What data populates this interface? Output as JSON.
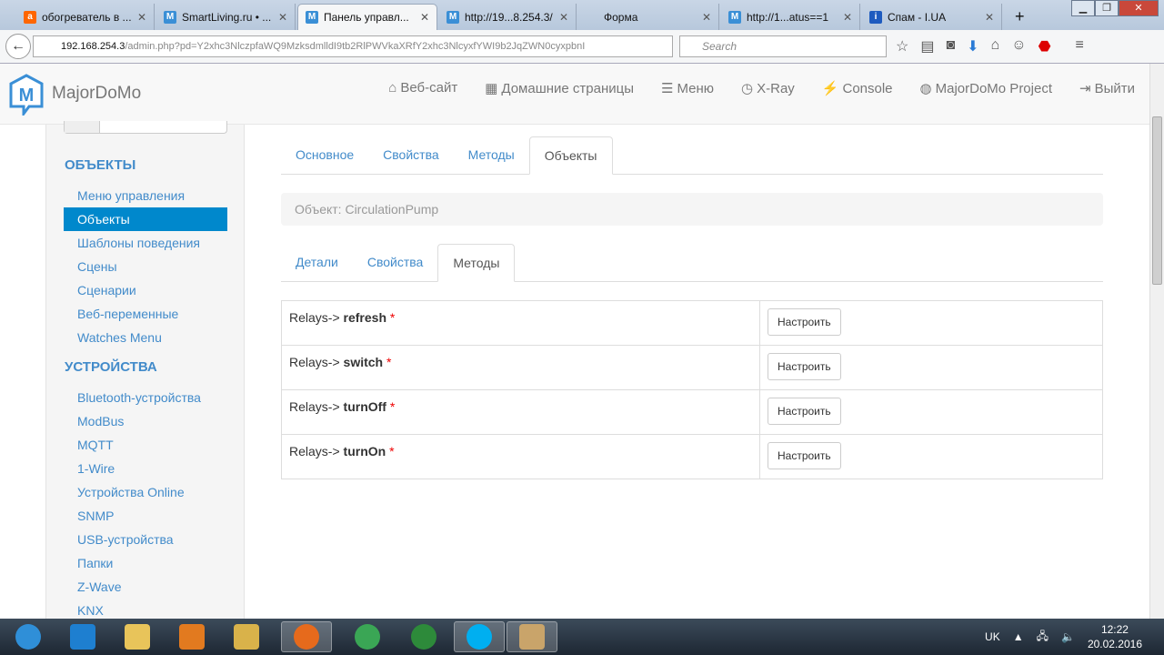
{
  "browser": {
    "tabs": [
      {
        "title": "обогреватель в ...",
        "icon": "amazon-icon",
        "color": "#f60"
      },
      {
        "title": "SmartLiving.ru • ...",
        "icon": "majordomo-icon",
        "color": "#3a8fd6"
      },
      {
        "title": "Панель управл...",
        "icon": "majordomo-icon",
        "color": "#3a8fd6",
        "active": true
      },
      {
        "title": "http://19...8.254.3/",
        "icon": "majordomo-icon",
        "color": "#3a8fd6"
      },
      {
        "title": "Форма",
        "icon": "",
        "color": ""
      },
      {
        "title": "http://1...atus==1",
        "icon": "majordomo-icon",
        "color": "#3a8fd6"
      },
      {
        "title": "Спам - I.UA",
        "icon": "info-icon",
        "color": "#1e5bbf"
      }
    ],
    "url_host": "192.168.254.3",
    "url_path": "/admin.php?pd=Y2xhc3NlczpfaWQ9MzksdmlldI9tb2RlPWVkaXRfY2xhc3NlcyxfYWI9b2JqZWN0cyxpbnI",
    "search_placeholder": "Search"
  },
  "navbar": {
    "brand": "MajorDoMo",
    "items": [
      {
        "label": "Веб-сайт",
        "icon": "home-icon",
        "glyph": "⌂"
      },
      {
        "label": "Домашние страницы",
        "icon": "grid-icon",
        "glyph": "▦"
      },
      {
        "label": "Меню",
        "icon": "list-icon",
        "glyph": "☰"
      },
      {
        "label": "X-Ray",
        "icon": "clock-icon",
        "glyph": "◷"
      },
      {
        "label": "Console",
        "icon": "bolt-icon",
        "glyph": "⚡"
      },
      {
        "label": "MajorDoMo Project",
        "icon": "globe-icon",
        "glyph": "◍"
      },
      {
        "label": "Выйти",
        "icon": "logout-icon",
        "glyph": "⇥"
      }
    ]
  },
  "sidebar": {
    "section1": "ОБЪЕКТЫ",
    "items1": [
      "Меню управления",
      "Объекты",
      "Шаблоны поведения",
      "Сцены",
      "Сценарии",
      "Веб-переменные",
      "Watches Menu"
    ],
    "active": "Объекты",
    "section2": "УСТРОЙСТВА",
    "items2": [
      "Bluetooth-устройства",
      "ModBus",
      "MQTT",
      "1-Wire",
      "Устройства Online",
      "SNMP",
      "USB-устройства",
      "Папки",
      "Z-Wave",
      "KNX"
    ]
  },
  "main": {
    "tabs": [
      "Основное",
      "Свойства",
      "Методы",
      "Объекты"
    ],
    "active_tab": "Объекты",
    "object_label": "Объект: CirculationPump",
    "subtabs": [
      "Детали",
      "Свойства",
      "Методы"
    ],
    "active_subtab": "Методы",
    "methods": [
      {
        "prefix": "Relays->",
        "name": "refresh",
        "button": "Настроить"
      },
      {
        "prefix": "Relays->",
        "name": "switch",
        "button": "Настроить"
      },
      {
        "prefix": "Relays->",
        "name": "turnOff",
        "button": "Настроить"
      },
      {
        "prefix": "Relays->",
        "name": "turnOn",
        "button": "Настроить"
      }
    ],
    "required_mark": "*"
  },
  "taskbar": {
    "apps": [
      "start",
      "internet-explorer",
      "file-explorer",
      "media-player",
      "archive",
      "firefox",
      "chrome",
      "utorrent",
      "skype",
      "paint"
    ],
    "active": [
      "firefox",
      "skype",
      "paint"
    ],
    "lang": "UK",
    "time": "12:22",
    "date": "20.02.2016"
  }
}
